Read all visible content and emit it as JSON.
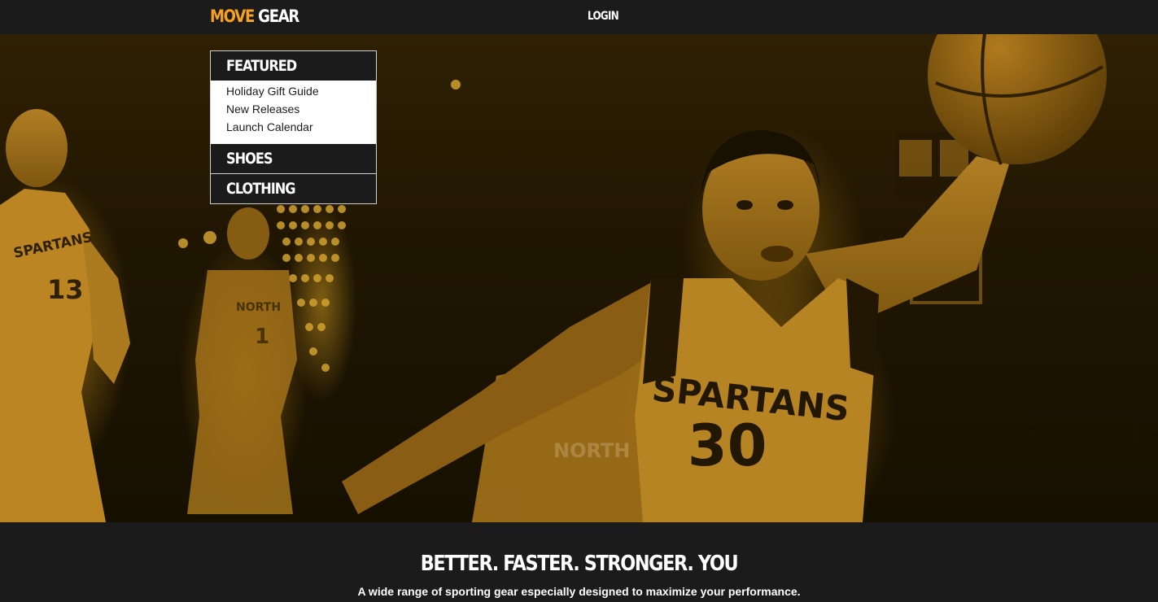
{
  "header": {
    "logo_part1": "MOVE",
    "logo_part2": "GEAR",
    "login_label": "LOGIN"
  },
  "menu": {
    "featured": {
      "label": "FEATURED",
      "items": [
        {
          "label": "Holiday Gift Guide"
        },
        {
          "label": "New Releases"
        },
        {
          "label": "Launch Calendar"
        }
      ]
    },
    "shoes": {
      "label": "SHOES"
    },
    "clothing": {
      "label": "CLOTHING"
    }
  },
  "hero": {
    "jersey_left_text": "SPARTANS",
    "jersey_left_number": "13",
    "jersey_center_text": "SPARTANS",
    "jersey_center_number": "30",
    "jersey_back_text": "NORTH",
    "jersey_back_number": "1",
    "jersey_front_text": "NORTH"
  },
  "intro": {
    "headline": "BETTER. FASTER. STRONGER. YOU",
    "subline": "A wide range of sporting gear especially designed to maximize your performance."
  },
  "colors": {
    "accent": "#f6a21e",
    "dark": "#1b1b1b",
    "text_light": "#ffffff"
  }
}
